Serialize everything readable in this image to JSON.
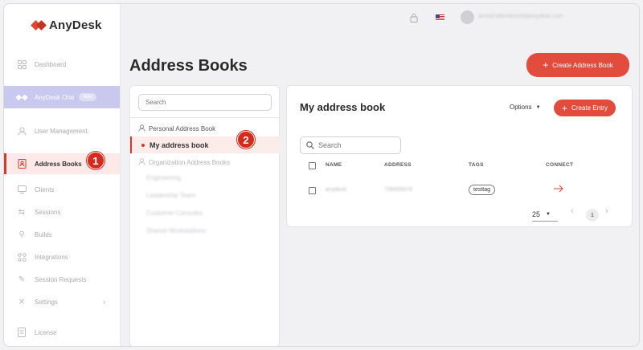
{
  "brand": {
    "name": "AnyDesk",
    "color": "#e2462d"
  },
  "topbar": {
    "user_email": "arnold.hillenbrecht@anydesk.com",
    "language": "EN-US"
  },
  "sidebar": {
    "items": [
      {
        "label": "Dashboard",
        "icon": "dashboard-icon"
      },
      {
        "label": "AnyDesk One",
        "badge": "New",
        "icon": "anydesk-icon"
      },
      {
        "label": "User Management",
        "icon": "user-icon"
      },
      {
        "label": "Address Books",
        "icon": "address-book-icon",
        "active": true
      },
      {
        "label": "Clients",
        "icon": "monitor-icon"
      },
      {
        "label": "Sessions",
        "icon": "sessions-icon"
      },
      {
        "label": "Builds",
        "icon": "builds-icon"
      },
      {
        "label": "Integrations",
        "icon": "integrations-icon"
      },
      {
        "label": "Session Requests",
        "icon": "session-requests-icon"
      },
      {
        "label": "Settings",
        "icon": "settings-icon",
        "chevron": "›"
      },
      {
        "label": "License",
        "icon": "license-icon"
      }
    ]
  },
  "markers": {
    "one": "1",
    "two": "2"
  },
  "page": {
    "title": "Address Books",
    "create_button": "Create Address Book"
  },
  "ab_panel": {
    "search_placeholder": "Search",
    "personal_header": "Personal Address Book",
    "personal_items": [
      "My address book"
    ],
    "org_header": "Organization Address Books",
    "org_items": [
      "Engineering",
      "Leadership Team",
      "Customer Consoles",
      "Shared Workstations"
    ]
  },
  "content": {
    "title": "My address book",
    "options_label": "Options",
    "create_entry": "Create Entry",
    "search_placeholder": "Search",
    "columns": {
      "name": "NAME",
      "address": "ADDRESS",
      "tags": "TAGS",
      "connect": "CONNECT"
    },
    "rows": [
      {
        "name": "anydesk",
        "address": "738495678",
        "tag": "testtag"
      }
    ],
    "page_size": "25",
    "page": "1"
  },
  "colors": {
    "accent": "#e24c3c",
    "active_bg": "#fde9e7",
    "anydesk_one_bg": "#c9c8ee"
  }
}
